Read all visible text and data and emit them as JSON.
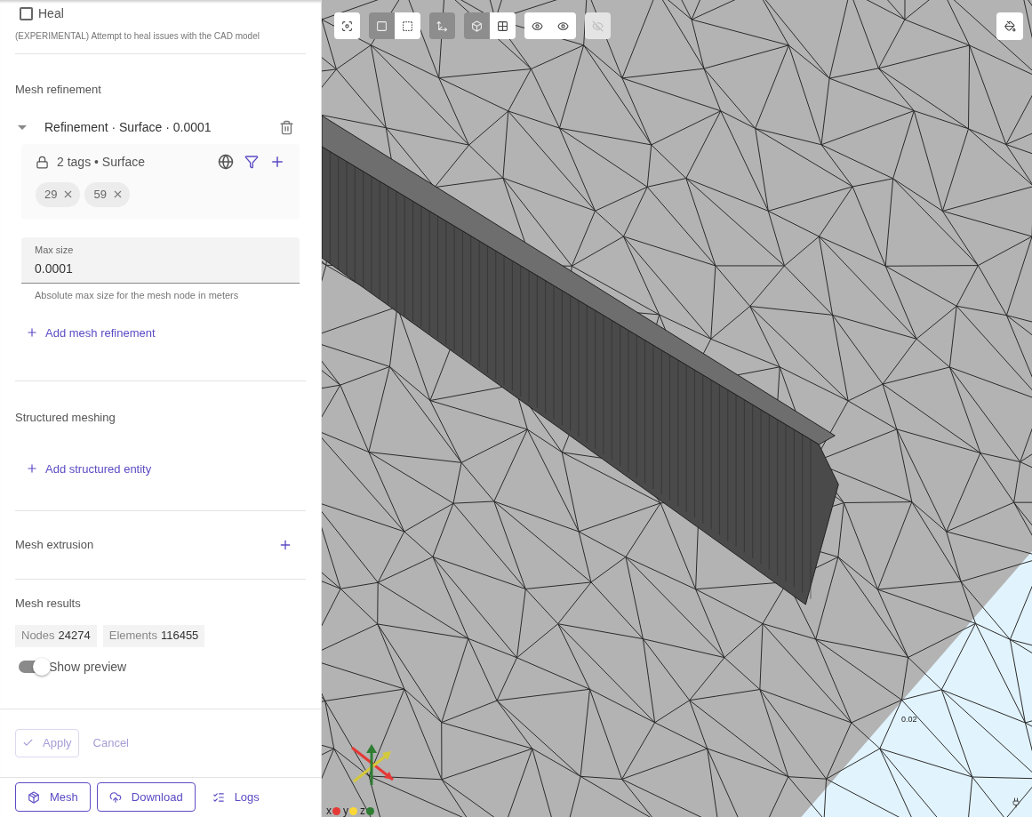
{
  "heal": {
    "label": "Heal",
    "checked": false,
    "description": "(EXPERIMENTAL) Attempt to heal issues with the CAD model"
  },
  "mesh_refinement": {
    "title": "Mesh refinement",
    "refinements": [
      {
        "title": "Refinement · Surface · 0.0001",
        "expanded": true,
        "selection": {
          "summary": "2 tags • Surface",
          "locked": true,
          "tags": [
            "29",
            "59"
          ]
        },
        "field": {
          "label": "Max size",
          "value": "0.0001",
          "helper": "Absolute max size for the mesh node in meters"
        }
      }
    ],
    "add_label": "Add mesh refinement"
  },
  "structured_meshing": {
    "title": "Structured meshing",
    "add_label": "Add structured entity"
  },
  "mesh_extrusion": {
    "title": "Mesh extrusion"
  },
  "mesh_results": {
    "title": "Mesh results",
    "stats": [
      {
        "label": "Nodes",
        "value": "24274"
      },
      {
        "label": "Elements",
        "value": "116455"
      }
    ],
    "preview": {
      "label": "Show preview",
      "on": true
    }
  },
  "form_actions": [
    {
      "kind": "apply",
      "label": "Apply",
      "disabled": true
    },
    {
      "kind": "cancel",
      "label": "Cancel",
      "disabled": true
    }
  ],
  "footer_actions": [
    {
      "kind": "mesh",
      "label": "Mesh"
    },
    {
      "kind": "download",
      "label": "Download"
    },
    {
      "kind": "logs",
      "label": "Logs"
    }
  ],
  "viewport": {
    "toolbar": [
      [
        {
          "kind": "fit",
          "selected": true,
          "disabled": false
        }
      ],
      [
        {
          "kind": "solid",
          "selected": false,
          "disabled": false
        },
        {
          "kind": "dashed",
          "selected": true,
          "disabled": false
        }
      ],
      [
        {
          "kind": "axes",
          "selected": false,
          "disabled": false
        }
      ],
      [
        {
          "kind": "perspective",
          "selected": false,
          "disabled": false
        },
        {
          "kind": "grid",
          "selected": true,
          "disabled": false
        }
      ],
      [
        {
          "kind": "show",
          "selected": true,
          "disabled": false
        },
        {
          "kind": "show-outline",
          "selected": true,
          "disabled": false
        }
      ],
      [
        {
          "kind": "hide",
          "disabled": true
        }
      ]
    ],
    "scale_label": "0.02",
    "axes": [
      {
        "label": "x",
        "color": "#e53935"
      },
      {
        "label": "y",
        "color": "#fdd835"
      },
      {
        "label": "z",
        "color": "#2e7d32"
      }
    ]
  }
}
